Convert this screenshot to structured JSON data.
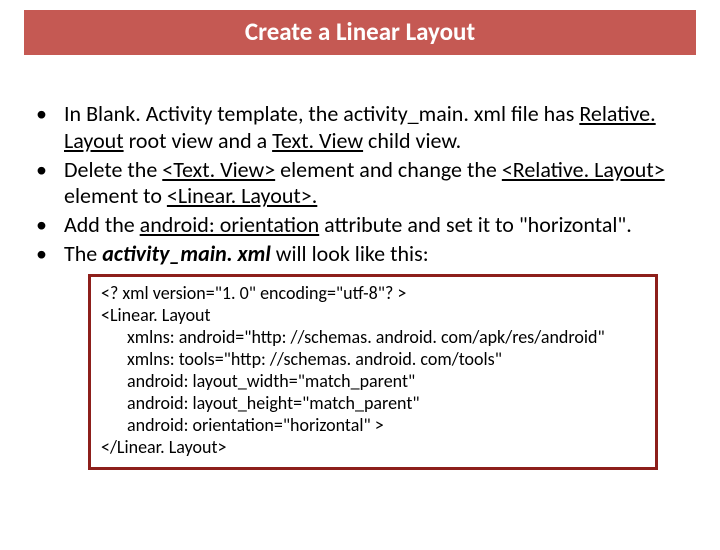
{
  "title": "Create a Linear Layout",
  "bullets": {
    "b1": {
      "t1": "In Blank. Activity template,  the activity_main. xml file has ",
      "u1": "Relative. Layout",
      "t2": " root view and a ",
      "u2": "Text. View",
      "t3": " child view."
    },
    "b2": {
      "t1": "Delete the ",
      "u1": "<Text. View>",
      "t2": " element and change the ",
      "u2": "<Relative. Layout>",
      "t3": " element to ",
      "u3": "<Linear. Layout>.",
      "t4": ""
    },
    "b3": {
      "t1": "Add the ",
      "u1": "android: orientation",
      "t2": " attribute and set it to \"horizontal\"."
    },
    "b4": {
      "t1": "The ",
      "bi1": "activity_main. xml",
      "t2": " will look like this:"
    }
  },
  "code": {
    "l1": "<? xml version=\"1. 0\" encoding=\"utf-8\"? >",
    "l2": "<Linear. Layout",
    "l3": "xmlns: android=\"http: //schemas. android. com/apk/res/android\"",
    "l4": "xmlns: tools=\"http: //schemas. android. com/tools\"",
    "l5": "android: layout_width=\"match_parent\"",
    "l6": "android: layout_height=\"match_parent\"",
    "l7": "android: orientation=\"horizontal\" >",
    "l8": "</Linear. Layout>"
  }
}
